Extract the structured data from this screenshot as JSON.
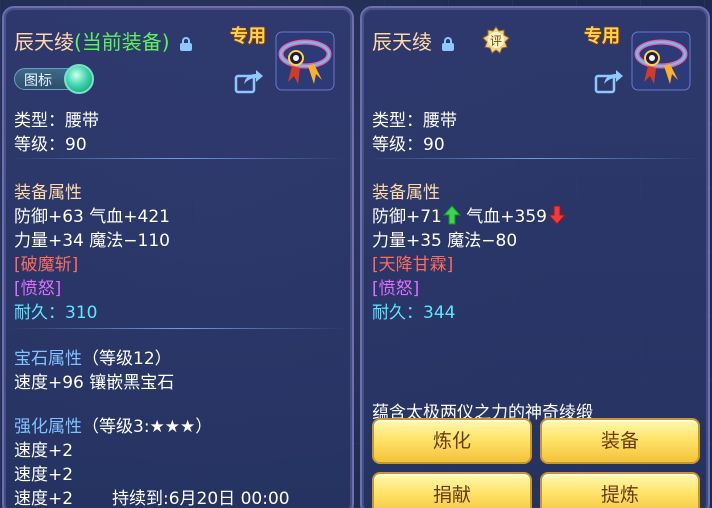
{
  "left": {
    "item_name": "辰天绫",
    "equipped_tag": "(当前装备)",
    "special_label": "专用",
    "tag_toggle_label": "图标",
    "type_line": "类型：腰带",
    "level_line": "等级：90",
    "attr_header": "装备属性",
    "attr_line1": "防御+63 气血+421",
    "attr_line2": "力量+34 魔法−110",
    "skill": "[破魔斩]",
    "rage": "[愤怒]",
    "durability_label": "耐久：",
    "durability_value": "310",
    "gem_header": "宝石属性",
    "gem_level": "（等级12）",
    "gem_line": "速度+96 镶嵌黑宝石",
    "enhance_header": "强化属性",
    "enhance_level": "（等级3:★★★）",
    "enhance_line1": "速度+2",
    "enhance_line2": "速度+2",
    "enhance_line3": "速度+2",
    "expire_text": "持续到:6月20日 00:00"
  },
  "right": {
    "item_name": "辰天绫",
    "rate_badge": "评",
    "special_label": "专用",
    "type_line": "类型：腰带",
    "level_line": "等级：90",
    "attr_header": "装备属性",
    "attr_def": "防御+71",
    "attr_hp": "气血+359",
    "attr_line2": "力量+35 魔法−80",
    "skill": "[天降甘霖]",
    "rage": "[愤怒]",
    "durability_label": "耐久：",
    "durability_value": "344",
    "description": "蕴含太极两仪之力的神奇绫缎",
    "buttons": {
      "refine": "炼化",
      "equip": "装备",
      "donate": "捐献",
      "extract": "提炼"
    }
  },
  "colors": {
    "gold_text": "#ffd24a",
    "equipped_green": "#5cf25c",
    "skill_red": "#ff6a5c",
    "rage_purple": "#e26cff",
    "cyan_value": "#5fe6ff",
    "section_blue": "#7fc2ff",
    "button_yellow": "#ffe46a"
  },
  "icons": [
    "lock-icon",
    "share-icon",
    "belt-icon",
    "rate-badge-icon",
    "arrow-up-icon",
    "arrow-down-icon",
    "toggle-knob"
  ]
}
